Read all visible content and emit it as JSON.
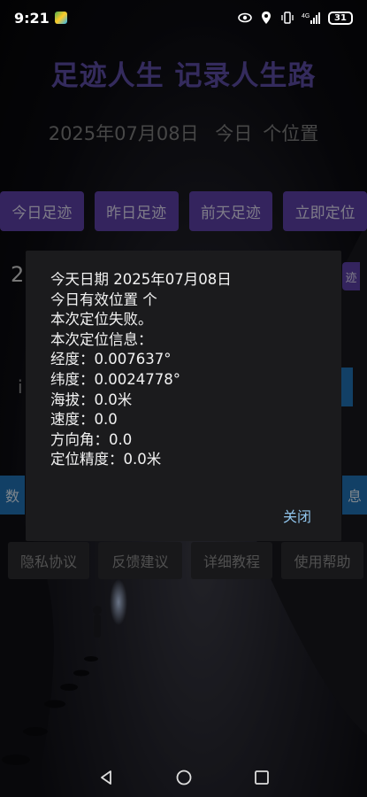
{
  "status_bar": {
    "time": "9:21",
    "network": "4G",
    "battery": "31"
  },
  "header": {
    "title": "足迹人生  记录人生路",
    "date": "2025年07月08日",
    "today_label": "今日",
    "count_label": "个位置"
  },
  "actions": {
    "today": "今日足迹",
    "yesterday": "昨日足迹",
    "day_before": "前天足迹",
    "locate_now": "立即定位"
  },
  "background_fragments": {
    "left_2": "2",
    "right_trace": "迹",
    "left_ji": "i",
    "left_shu": "数",
    "right_xi": "息"
  },
  "footer_links": {
    "privacy": "隐私协议",
    "feedback": "反馈建议",
    "tutorial": "详细教程",
    "help": "使用帮助"
  },
  "dialog": {
    "lines": [
      "今天日期 2025年07月08日",
      "今日有效位置  个",
      "本次定位失败。",
      "本次定位信息：",
      "经度：0.007637°",
      "纬度：0.0024778°",
      "海拔：0.0米",
      "速度：0.0",
      "方向角：0.0",
      "定位精度：0.0米"
    ],
    "close_label": "关闭"
  },
  "colors": {
    "accent_purple": "#5b3fa3",
    "title_purple": "#5b4aa0",
    "link_blue": "#8fc3ea"
  }
}
